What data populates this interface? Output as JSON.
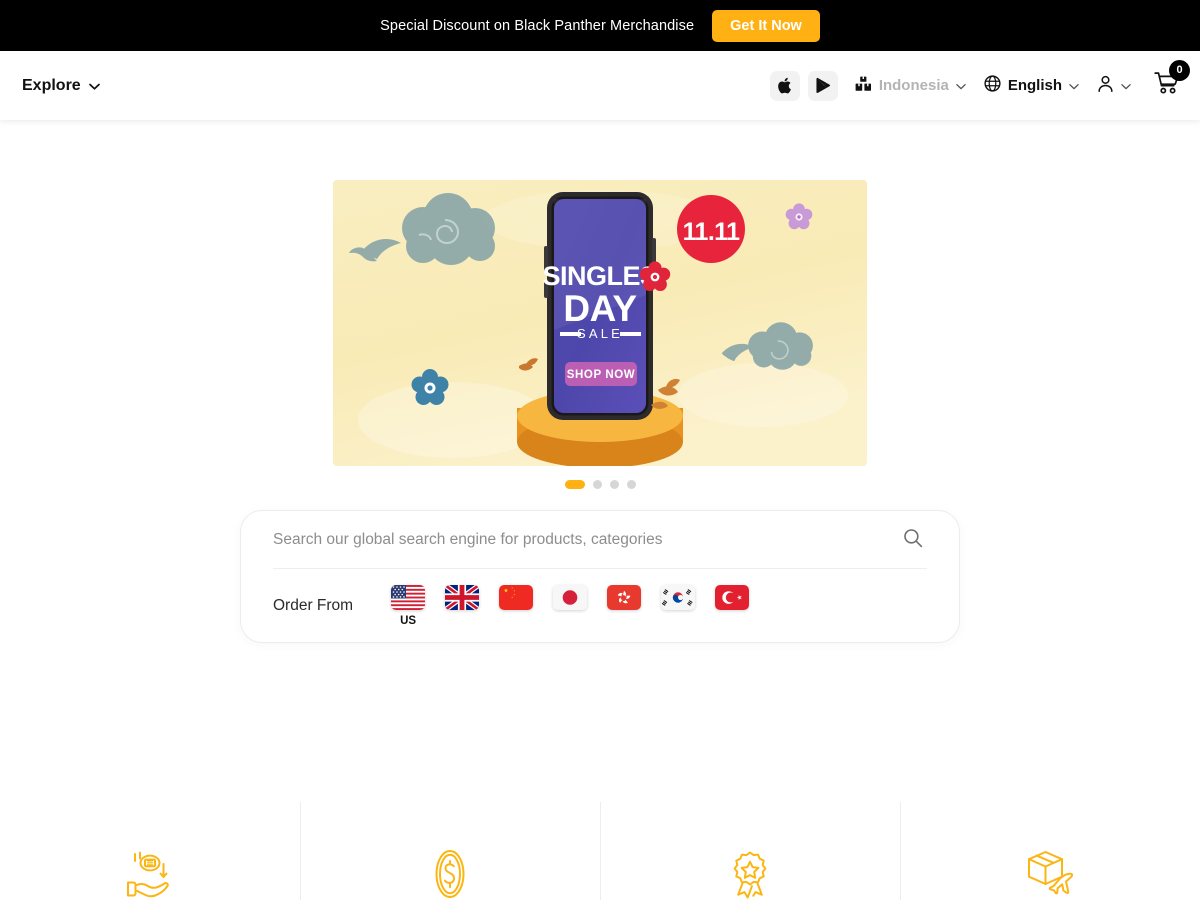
{
  "promo": {
    "text": "Special Discount on Black Panther Merchandise",
    "button_label": "Get It Now",
    "button_color": "#FFB013",
    "bar_color": "#000000"
  },
  "navbar": {
    "explore_label": "Explore",
    "explore_chevron": "chevron-down-icon",
    "app_store_icon": "apple-icon",
    "play_store_icon": "google-play-icon",
    "country": {
      "label": "Indonesia",
      "icon": "warehouse-boxes-icon",
      "chevron": "chevron-down-icon"
    },
    "language": {
      "label": "English",
      "icon": "globe-icon",
      "chevron": "chevron-down-icon"
    },
    "account": {
      "icon": "user-icon",
      "chevron": "chevron-down-icon"
    },
    "cart": {
      "icon": "cart-icon",
      "count": "0"
    }
  },
  "hero": {
    "banner": {
      "badge": "11.11",
      "title_line1": "SINGLES",
      "title_line2": "DAY",
      "title_line3": "SALE",
      "cta": "SHOP NOW",
      "bg_color": "#faeec0",
      "phone_screen_color": "#4a44a8",
      "badge_color": "#e8243c",
      "cta_color": "#bb5fb5",
      "podium_color": "#f0a429"
    },
    "carousel": {
      "total": 4,
      "active_index": 0,
      "active_color": "#FFB013",
      "inactive_color": "#d6d6d6"
    }
  },
  "search": {
    "placeholder": "Search our global search engine for products, categories",
    "value": "",
    "search_icon": "search-icon",
    "order_from_label": "Order From",
    "countries": [
      {
        "code": "US",
        "name": "United States",
        "show_code": true
      },
      {
        "code": "UK",
        "name": "United Kingdom",
        "show_code": false
      },
      {
        "code": "CN",
        "name": "China",
        "show_code": false
      },
      {
        "code": "JP",
        "name": "Japan",
        "show_code": false
      },
      {
        "code": "HK",
        "name": "Hong Kong",
        "show_code": false
      },
      {
        "code": "KR",
        "name": "South Korea",
        "show_code": false
      },
      {
        "code": "TR",
        "name": "Turkey",
        "show_code": false
      }
    ]
  },
  "features": {
    "accent_color": "#FBB614",
    "items": [
      {
        "icon": "hand-cashback-icon"
      },
      {
        "icon": "dollar-coin-icon"
      },
      {
        "icon": "award-badge-icon"
      },
      {
        "icon": "package-airplane-icon"
      }
    ]
  }
}
